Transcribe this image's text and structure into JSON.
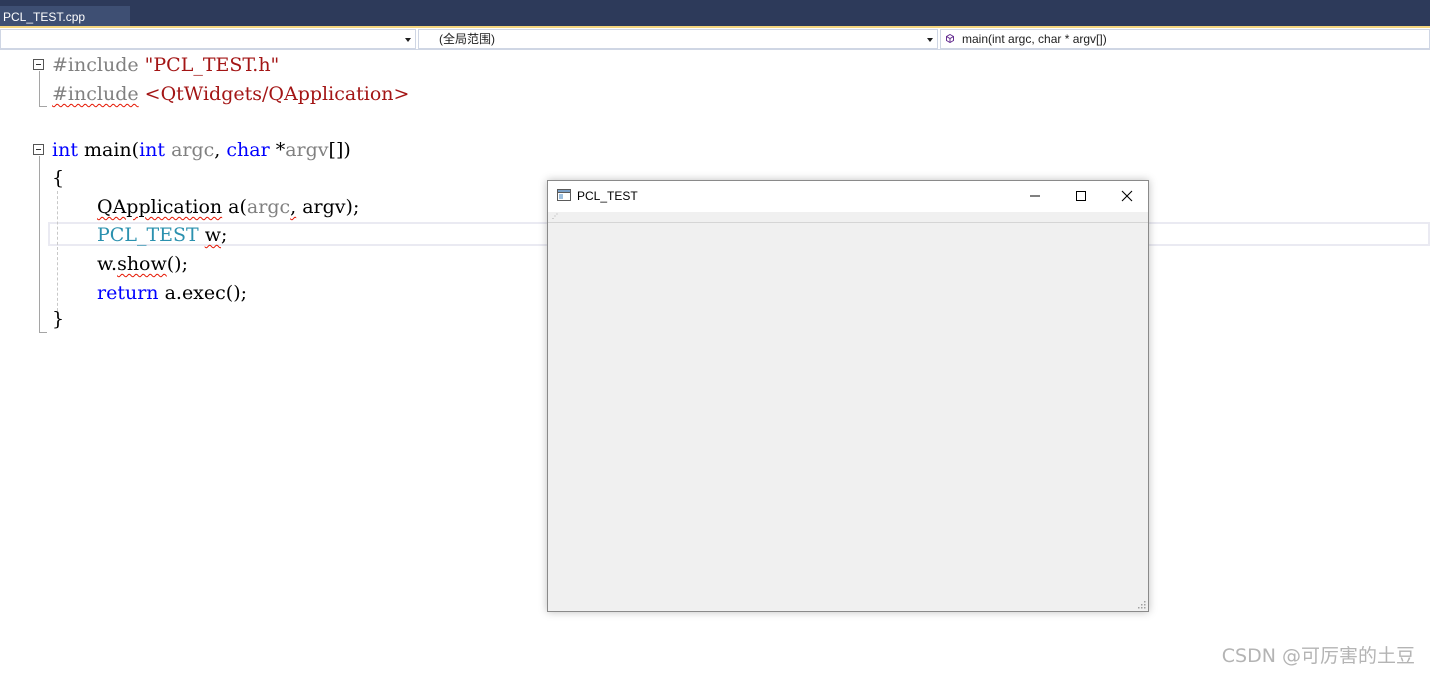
{
  "tabs": [
    {
      "label": "PCL_TEST.cpp"
    }
  ],
  "navbar": {
    "project_combo": "",
    "scope_combo": "(全局范围)",
    "member_combo": "main(int argc, char * argv[])"
  },
  "code": {
    "l1": {
      "pp": "#include",
      "str": "\"PCL_TEST.h\""
    },
    "l2": {
      "pp": "#include",
      "str": "<QtWidgets/QApplication>"
    },
    "l4": {
      "kw1": "int",
      "fn": "main(",
      "kw2": "int",
      "p1": "argc",
      "sep": ", ",
      "kw3": "char",
      "star": " *",
      "p2": "argv",
      "end": "[])"
    },
    "l5": "{",
    "l6": {
      "type": "QApplication",
      "rest1": " a(",
      "p1": "argc",
      "comma": ",",
      "rest2": " argv);"
    },
    "l7": {
      "type": "PCL_TEST",
      "var": "w",
      "end": ";"
    },
    "l8": {
      "obj": "w.",
      "fn": "show",
      "end": "();"
    },
    "l9": {
      "kw": "return",
      "rest": " a.exec();"
    },
    "l10": "}"
  },
  "qt_window": {
    "title": "PCL_TEST"
  },
  "watermark": "CSDN @可厉害的土豆",
  "colors": {
    "keyword": "#0000ff",
    "preprocessor": "#808080",
    "string": "#a31515",
    "type": "#2b91af",
    "tab_bg": "#2d3a5a",
    "squiggle": "#e51400"
  }
}
